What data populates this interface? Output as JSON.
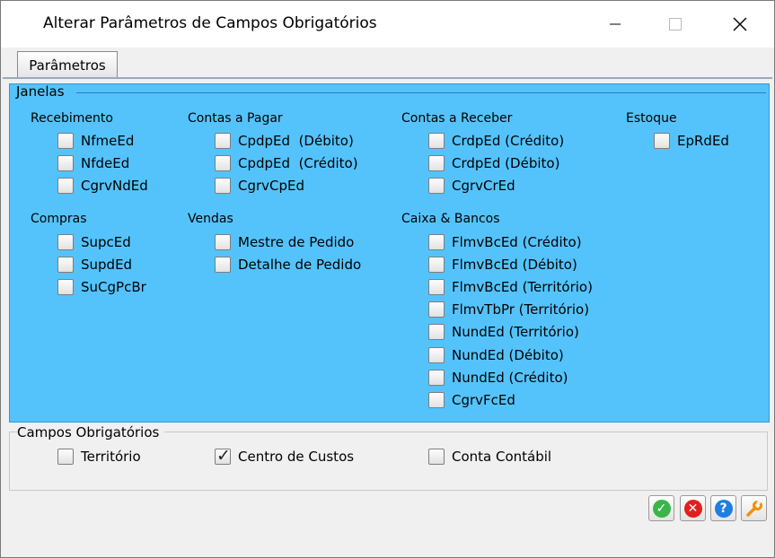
{
  "window": {
    "title": "Alterar Parâmetros de Campos Obrigatórios"
  },
  "tab": {
    "label": "Parâmetros"
  },
  "janelas": {
    "label": "Janelas",
    "recebimento": {
      "header": "Recebimento",
      "items": [
        "NfmeEd",
        "NfdeEd",
        "CgrvNdEd"
      ]
    },
    "contas_pagar": {
      "header": "Contas a Pagar",
      "items": [
        "CpdpEd  (Débito)",
        "CpdpEd  (Crédito)",
        "CgrvCpEd"
      ]
    },
    "contas_receber": {
      "header": "Contas a Receber",
      "items": [
        "CrdpEd (Crédito)",
        "CrdpEd (Débito)",
        "CgrvCrEd"
      ]
    },
    "estoque": {
      "header": "Estoque",
      "items": [
        "EpRdEd"
      ]
    },
    "compras": {
      "header": "Compras",
      "items": [
        "SupcEd",
        "SupdEd",
        "SuCgPcBr"
      ]
    },
    "vendas": {
      "header": "Vendas",
      "items": [
        "Mestre de Pedido",
        "Detalhe de Pedido"
      ]
    },
    "caixa_bancos": {
      "header": "Caixa & Bancos",
      "items": [
        "FlmvBcEd (Crédito)",
        "FlmvBcEd (Débito)",
        "FlmvBcEd (Território)",
        "FlmvTbPr (Território)",
        "NundEd (Território)",
        "NundEd (Débito)",
        "NundEd (Crédito)",
        "CgrvFcEd"
      ]
    }
  },
  "campos": {
    "label": "Campos Obrigatórios",
    "items": [
      {
        "label": "Território",
        "checked": false
      },
      {
        "label": "Centro de Custos",
        "checked": true
      },
      {
        "label": "Conta Contábil",
        "checked": false
      }
    ]
  },
  "icons": {
    "ok": "check-icon",
    "cancel": "close-icon",
    "help": "help-icon",
    "config": "wrench-icon"
  },
  "colors": {
    "panel": "#54c3fc",
    "ok": "#39b54a",
    "cancel": "#e02020",
    "help": "#1f7ee0",
    "config": "#f29100"
  }
}
